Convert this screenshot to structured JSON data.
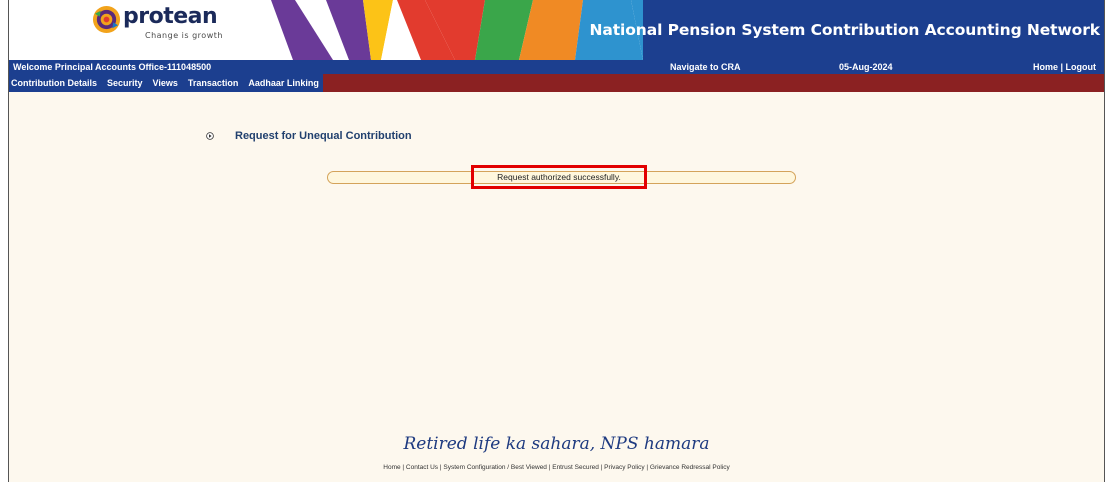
{
  "header": {
    "logo_name": "protean",
    "logo_tagline": "Change is growth",
    "site_title": "National Pension System Contribution Accounting Network"
  },
  "welcome_bar": {
    "welcome_text": "Welcome Principal Accounts Office-111048500",
    "navigate_label": "Navigate to CRA",
    "date": "05-Aug-2024",
    "home_logout": "Home | Logout"
  },
  "menu": {
    "items": [
      {
        "label": "Contribution Details"
      },
      {
        "label": "Security"
      },
      {
        "label": "Views"
      },
      {
        "label": "Transaction"
      },
      {
        "label": "Aadhaar Linking"
      }
    ]
  },
  "main": {
    "section_title": "Request for Unequal Contribution",
    "message": "Request authorized successfully."
  },
  "footer": {
    "slogan": "Retired life ka sahara, NPS hamara",
    "links": "Home | Contact Us | System Configuration / Best Viewed | Entrust Secured | Privacy Policy | Grievance Redressal Policy"
  },
  "colors": {
    "header_blue": "#1c3f8f",
    "menu_maroon": "#8b2122",
    "page_bg": "#fdf8ee",
    "highlight_red": "#e20000"
  },
  "icons": {
    "logo": "protean-logo-icon",
    "bullet": "circle-arrow-bullet-icon"
  }
}
